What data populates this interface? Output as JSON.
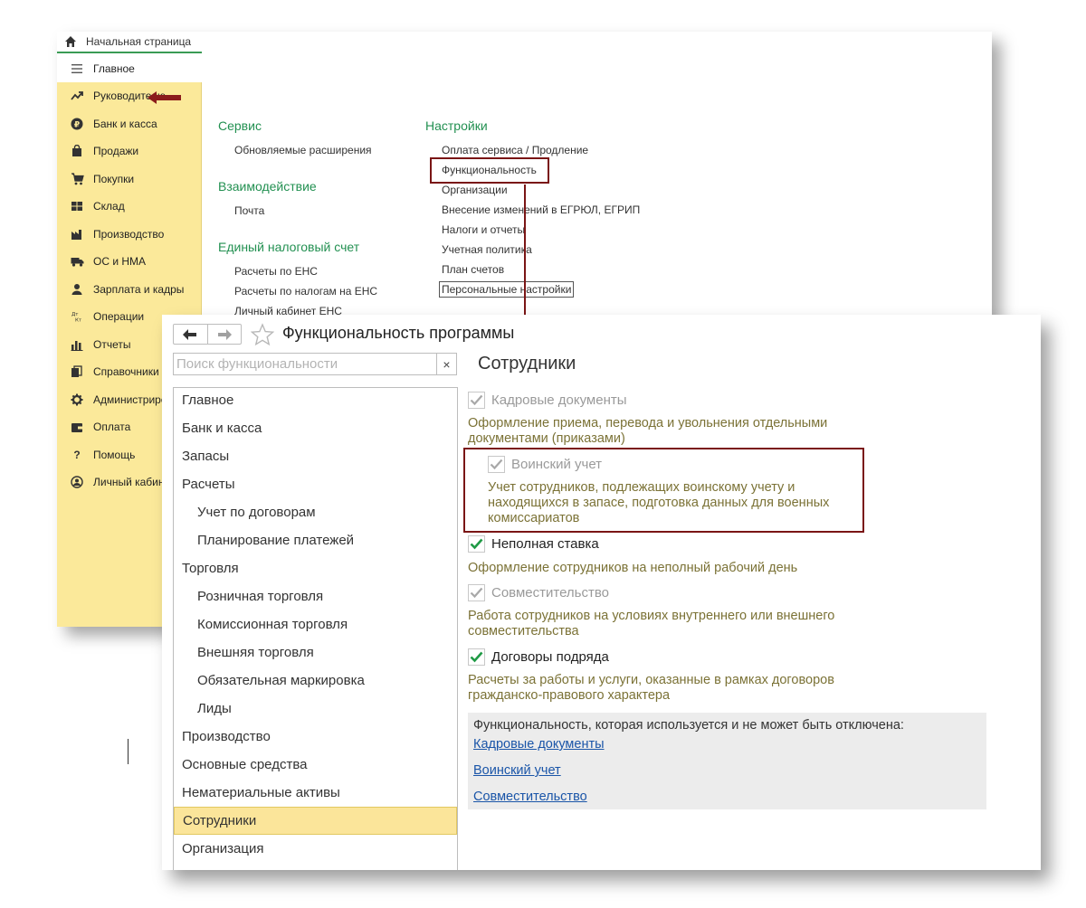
{
  "back_window": {
    "home_tab": "Начальная страница",
    "sidebar": [
      {
        "label": "Главное",
        "icon": "menu-icon",
        "active": true
      },
      {
        "label": "Руководителю",
        "icon": "trend-icon"
      },
      {
        "label": "Банк и касса",
        "icon": "ruble-icon"
      },
      {
        "label": "Продажи",
        "icon": "bag-icon"
      },
      {
        "label": "Покупки",
        "icon": "cart-icon"
      },
      {
        "label": "Склад",
        "icon": "warehouse-icon"
      },
      {
        "label": "Производство",
        "icon": "factory-icon"
      },
      {
        "label": "ОС и НМА",
        "icon": "truck-icon"
      },
      {
        "label": "Зарплата и кадры",
        "icon": "person-icon"
      },
      {
        "label": "Операции",
        "icon": "dt-kt-icon"
      },
      {
        "label": "Отчеты",
        "icon": "bar-chart-icon"
      },
      {
        "label": "Справочники",
        "icon": "books-icon"
      },
      {
        "label": "Администриро",
        "icon": "gear-icon"
      },
      {
        "label": "Оплата",
        "icon": "wallet-icon"
      },
      {
        "label": "Помощь",
        "icon": "question-icon"
      },
      {
        "label": "Личный кабине",
        "icon": "user-circle-icon"
      }
    ],
    "sections": {
      "service": {
        "title": "Сервис",
        "links": [
          "Обновляемые расширения"
        ]
      },
      "interaction": {
        "title": "Взаимодействие",
        "links": [
          "Почта"
        ]
      },
      "ens": {
        "title": "Единый налоговый счет",
        "links": [
          "Расчеты по ЕНС",
          "Расчеты по налогам на ЕНС",
          "Личный кабинет ЕНС"
        ]
      },
      "settings": {
        "title": "Настройки",
        "links": [
          "Оплата сервиса / Продление",
          "Функциональность",
          "Организации",
          "Внесение изменений в ЕГРЮЛ, ЕГРИП",
          "Налоги и отчеты",
          "Учетная политика",
          "План счетов",
          "Персональные настройки"
        ]
      }
    }
  },
  "front_window": {
    "title": "Функциональность программы",
    "search_placeholder": "Поиск функциональности",
    "search_clear": "×",
    "tree": [
      {
        "label": "Главное",
        "child": false
      },
      {
        "label": "Банк и касса",
        "child": false
      },
      {
        "label": "Запасы",
        "child": false
      },
      {
        "label": "Расчеты",
        "child": false
      },
      {
        "label": "Учет по договорам",
        "child": true
      },
      {
        "label": "Планирование платежей",
        "child": true
      },
      {
        "label": "Торговля",
        "child": false
      },
      {
        "label": "Розничная торговля",
        "child": true
      },
      {
        "label": "Комиссионная торговля",
        "child": true
      },
      {
        "label": "Внешняя торговля",
        "child": true
      },
      {
        "label": "Обязательная маркировка",
        "child": true
      },
      {
        "label": "Лиды",
        "child": true
      },
      {
        "label": "Производство",
        "child": false
      },
      {
        "label": "Основные средства",
        "child": false
      },
      {
        "label": "Нематериальные активы",
        "child": false
      },
      {
        "label": "Сотрудники",
        "child": false,
        "selected": true
      },
      {
        "label": "Организация",
        "child": false
      }
    ],
    "panel_title": "Сотрудники",
    "options": [
      {
        "label": "Кадровые документы",
        "checked": true,
        "enabled": false,
        "desc": "Оформление приема, перевода и увольнения отдельными документами (приказами)"
      },
      {
        "label": "Воинский учет",
        "checked": true,
        "enabled": false,
        "desc": "Учет сотрудников, подлежащих воинскому учету и находящихся в запасе, подготовка данных для военных комиссариатов"
      },
      {
        "label": "Неполная ставка",
        "checked": true,
        "enabled": true,
        "desc": "Оформление сотрудников на неполный рабочий день"
      },
      {
        "label": "Совместительство",
        "checked": true,
        "enabled": false,
        "desc": "Работа сотрудников на условиях внутреннего или внешнего совместительства"
      },
      {
        "label": "Договоры подряда",
        "checked": true,
        "enabled": true,
        "desc": "Расчеты за работы и услуги, оказанные в рамках договоров гражданско-правового характера"
      }
    ],
    "info_box": {
      "text": "Функциональность, которая используется и не может быть отключена:",
      "links": [
        "Кадровые документы",
        "Воинский учет",
        "Совместительство"
      ]
    }
  },
  "colors": {
    "sidebar_bg": "#fbe99a",
    "section_green": "#229051",
    "highlight_red": "#7a1515",
    "desc_olive": "#7b7236",
    "link_blue": "#1a55a8",
    "selected_yellow": "#fbe59a",
    "check_green": "#1f9a45"
  }
}
